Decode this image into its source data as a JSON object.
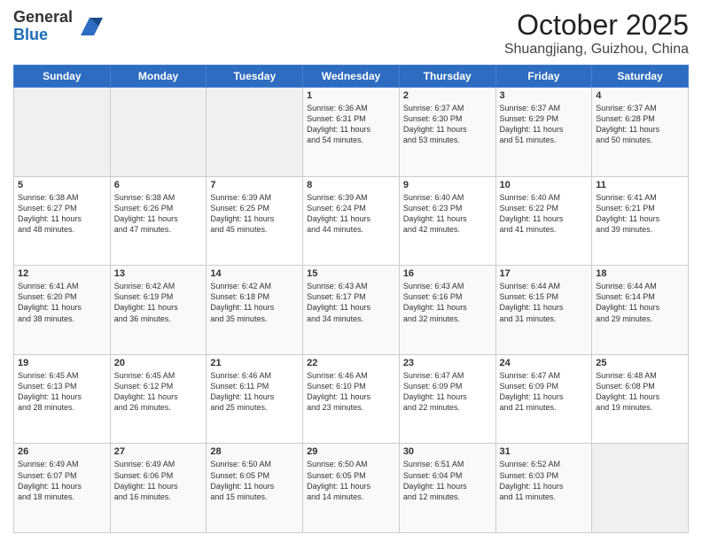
{
  "logo": {
    "general": "General",
    "blue": "Blue"
  },
  "header": {
    "month": "October 2025",
    "location": "Shuangjiang, Guizhou, China"
  },
  "weekdays": [
    "Sunday",
    "Monday",
    "Tuesday",
    "Wednesday",
    "Thursday",
    "Friday",
    "Saturday"
  ],
  "weeks": [
    [
      {
        "day": "",
        "info": ""
      },
      {
        "day": "",
        "info": ""
      },
      {
        "day": "",
        "info": ""
      },
      {
        "day": "1",
        "info": "Sunrise: 6:36 AM\nSunset: 6:31 PM\nDaylight: 11 hours\nand 54 minutes."
      },
      {
        "day": "2",
        "info": "Sunrise: 6:37 AM\nSunset: 6:30 PM\nDaylight: 11 hours\nand 53 minutes."
      },
      {
        "day": "3",
        "info": "Sunrise: 6:37 AM\nSunset: 6:29 PM\nDaylight: 11 hours\nand 51 minutes."
      },
      {
        "day": "4",
        "info": "Sunrise: 6:37 AM\nSunset: 6:28 PM\nDaylight: 11 hours\nand 50 minutes."
      }
    ],
    [
      {
        "day": "5",
        "info": "Sunrise: 6:38 AM\nSunset: 6:27 PM\nDaylight: 11 hours\nand 48 minutes."
      },
      {
        "day": "6",
        "info": "Sunrise: 6:38 AM\nSunset: 6:26 PM\nDaylight: 11 hours\nand 47 minutes."
      },
      {
        "day": "7",
        "info": "Sunrise: 6:39 AM\nSunset: 6:25 PM\nDaylight: 11 hours\nand 45 minutes."
      },
      {
        "day": "8",
        "info": "Sunrise: 6:39 AM\nSunset: 6:24 PM\nDaylight: 11 hours\nand 44 minutes."
      },
      {
        "day": "9",
        "info": "Sunrise: 6:40 AM\nSunset: 6:23 PM\nDaylight: 11 hours\nand 42 minutes."
      },
      {
        "day": "10",
        "info": "Sunrise: 6:40 AM\nSunset: 6:22 PM\nDaylight: 11 hours\nand 41 minutes."
      },
      {
        "day": "11",
        "info": "Sunrise: 6:41 AM\nSunset: 6:21 PM\nDaylight: 11 hours\nand 39 minutes."
      }
    ],
    [
      {
        "day": "12",
        "info": "Sunrise: 6:41 AM\nSunset: 6:20 PM\nDaylight: 11 hours\nand 38 minutes."
      },
      {
        "day": "13",
        "info": "Sunrise: 6:42 AM\nSunset: 6:19 PM\nDaylight: 11 hours\nand 36 minutes."
      },
      {
        "day": "14",
        "info": "Sunrise: 6:42 AM\nSunset: 6:18 PM\nDaylight: 11 hours\nand 35 minutes."
      },
      {
        "day": "15",
        "info": "Sunrise: 6:43 AM\nSunset: 6:17 PM\nDaylight: 11 hours\nand 34 minutes."
      },
      {
        "day": "16",
        "info": "Sunrise: 6:43 AM\nSunset: 6:16 PM\nDaylight: 11 hours\nand 32 minutes."
      },
      {
        "day": "17",
        "info": "Sunrise: 6:44 AM\nSunset: 6:15 PM\nDaylight: 11 hours\nand 31 minutes."
      },
      {
        "day": "18",
        "info": "Sunrise: 6:44 AM\nSunset: 6:14 PM\nDaylight: 11 hours\nand 29 minutes."
      }
    ],
    [
      {
        "day": "19",
        "info": "Sunrise: 6:45 AM\nSunset: 6:13 PM\nDaylight: 11 hours\nand 28 minutes."
      },
      {
        "day": "20",
        "info": "Sunrise: 6:45 AM\nSunset: 6:12 PM\nDaylight: 11 hours\nand 26 minutes."
      },
      {
        "day": "21",
        "info": "Sunrise: 6:46 AM\nSunset: 6:11 PM\nDaylight: 11 hours\nand 25 minutes."
      },
      {
        "day": "22",
        "info": "Sunrise: 6:46 AM\nSunset: 6:10 PM\nDaylight: 11 hours\nand 23 minutes."
      },
      {
        "day": "23",
        "info": "Sunrise: 6:47 AM\nSunset: 6:09 PM\nDaylight: 11 hours\nand 22 minutes."
      },
      {
        "day": "24",
        "info": "Sunrise: 6:47 AM\nSunset: 6:09 PM\nDaylight: 11 hours\nand 21 minutes."
      },
      {
        "day": "25",
        "info": "Sunrise: 6:48 AM\nSunset: 6:08 PM\nDaylight: 11 hours\nand 19 minutes."
      }
    ],
    [
      {
        "day": "26",
        "info": "Sunrise: 6:49 AM\nSunset: 6:07 PM\nDaylight: 11 hours\nand 18 minutes."
      },
      {
        "day": "27",
        "info": "Sunrise: 6:49 AM\nSunset: 6:06 PM\nDaylight: 11 hours\nand 16 minutes."
      },
      {
        "day": "28",
        "info": "Sunrise: 6:50 AM\nSunset: 6:05 PM\nDaylight: 11 hours\nand 15 minutes."
      },
      {
        "day": "29",
        "info": "Sunrise: 6:50 AM\nSunset: 6:05 PM\nDaylight: 11 hours\nand 14 minutes."
      },
      {
        "day": "30",
        "info": "Sunrise: 6:51 AM\nSunset: 6:04 PM\nDaylight: 11 hours\nand 12 minutes."
      },
      {
        "day": "31",
        "info": "Sunrise: 6:52 AM\nSunset: 6:03 PM\nDaylight: 11 hours\nand 11 minutes."
      },
      {
        "day": "",
        "info": ""
      }
    ]
  ]
}
